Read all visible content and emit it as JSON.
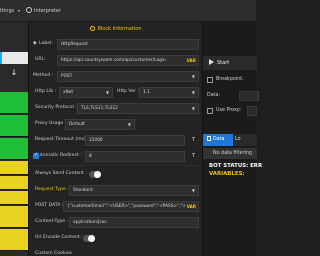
{
  "topbar": {
    "settings_label": "ttings",
    "interpreter_label": "Interpreter"
  },
  "center": {
    "block_title": "Block Information",
    "label": {
      "label": "Label:",
      "value": "HttpRequest"
    },
    "url": {
      "label": "URL:",
      "value": "https://api.countrysoem.com/api/customer/Login",
      "var": "VAR"
    },
    "method": {
      "label": "Method :",
      "value": "POST"
    },
    "http_lib": {
      "label": "Http Lib :",
      "value": "xNet"
    },
    "http_ver": {
      "label": "Http Ver :",
      "value": "1.1"
    },
    "security": {
      "label": "Security Protocol :",
      "value": "TLS,TLS11,TLS12"
    },
    "proxy": {
      "label": "Proxy Usage :",
      "value": "Default"
    },
    "timeout": {
      "label": "Request Timeout (ms) :",
      "value": "15000",
      "t": "T"
    },
    "auto_redirect": {
      "label": "Automatic Redirect :",
      "value": "8",
      "t": "T",
      "checked": true
    },
    "always_send": {
      "label": "Always Send Content :"
    },
    "request_type": {
      "label": "Request Type :",
      "value": "Standard"
    },
    "post_data": {
      "label": "POST DATA :",
      "value": "{\"customerEmail\":\"<USER>\",\"password\":\"<PASS>\",\"inco",
      "var": "VAR"
    },
    "content_type": {
      "label": "Content-Type :",
      "value": "application/json"
    },
    "url_encode": {
      "label": "Url Encode Content :"
    },
    "custom_cookies": {
      "label": "Custom Cookies"
    }
  },
  "right": {
    "start_label": "Start",
    "breakpoint_label": "Breakpoint:",
    "data_label": "Data:",
    "use_proxy_label": "Use Proxy:",
    "tab_data": "Data",
    "tab_log": "Lo",
    "no_data": "No data filtering",
    "bot_status": "BOT STATUS: ERR",
    "variables": "VARIABLES:"
  },
  "colors": {
    "accent_yellow": "#f0c419",
    "accent_blue": "#1e78d7",
    "green_block": "#1fbf3a",
    "yellow_block": "#e6d21f"
  }
}
